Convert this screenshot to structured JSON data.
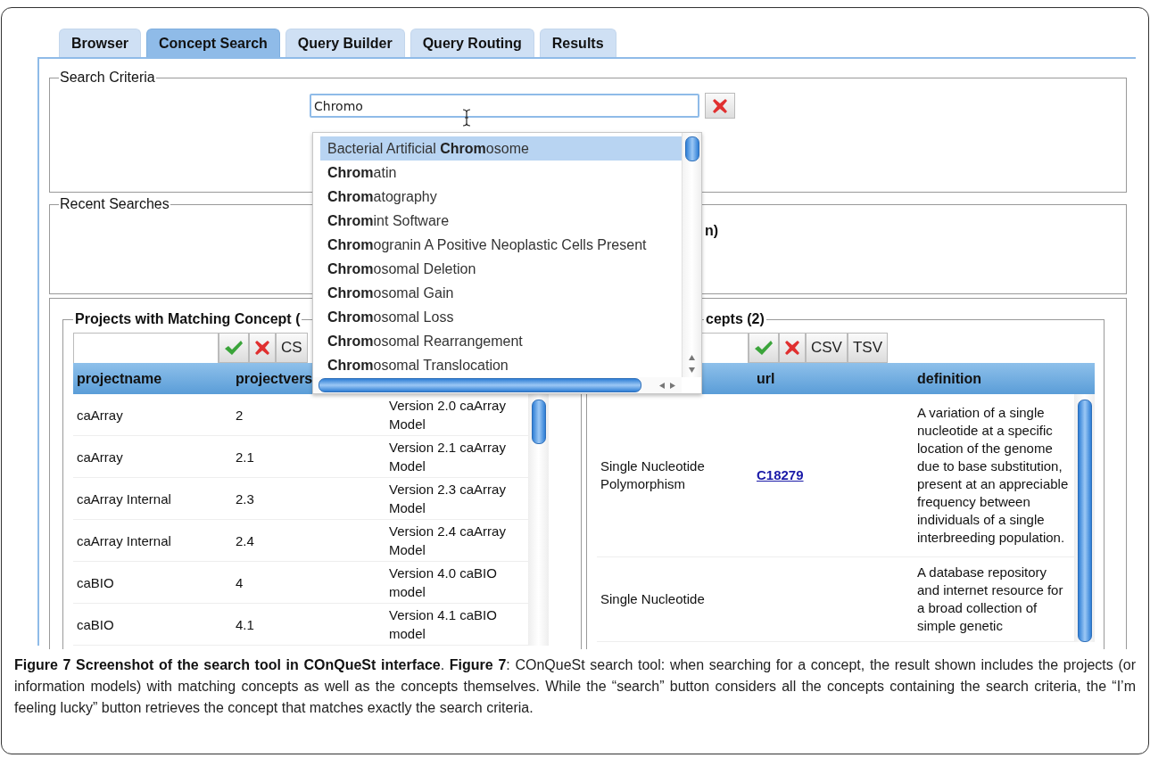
{
  "tabs": [
    {
      "label": "Browser",
      "selected": false
    },
    {
      "label": "Concept Search",
      "selected": true
    },
    {
      "label": "Query Builder",
      "selected": false
    },
    {
      "label": "Query Routing",
      "selected": false
    },
    {
      "label": "Results",
      "selected": false
    }
  ],
  "search_criteria": {
    "title": "Search Criteria",
    "value": "Chromo"
  },
  "suggestions": [
    {
      "label": "Bacterial Artificial **Chrom**osome",
      "selected": true
    },
    {
      "label": "**Chrom**atin",
      "selected": false
    },
    {
      "label": "**Chrom**atography",
      "selected": false
    },
    {
      "label": "**Chrom**int Software",
      "selected": false
    },
    {
      "label": "**Chrom**ogranin A Positive Neoplastic Cells Present",
      "selected": false
    },
    {
      "label": "**Chrom**osomal Deletion",
      "selected": false
    },
    {
      "label": "**Chrom**osomal Gain",
      "selected": false
    },
    {
      "label": "**Chrom**osomal Loss",
      "selected": false
    },
    {
      "label": "**Chrom**osomal Rearrangement",
      "selected": false
    },
    {
      "label": "**Chrom**osomal Translocation",
      "selected": false
    }
  ],
  "recent_searches": {
    "title": "Recent Searches",
    "text": "n)"
  },
  "tables": [
    {
      "title": "Projects with Matching Concept (",
      "buttons": [
        "CS"
      ],
      "columns": [
        "projectname",
        "projectvers"
      ],
      "rows": [
        [
          "caArray",
          "2",
          "Version 2.0 caArray Model"
        ],
        [
          "caArray",
          "2.1",
          "Version 2.1 caArray Model"
        ],
        [
          "caArray Internal",
          "2.3",
          "Version 2.3 caArray Model"
        ],
        [
          "caArray Internal",
          "2.4",
          "Version 2.4 caArray Model"
        ],
        [
          "caBIO",
          "4",
          "Version 4.0 caBIO model"
        ],
        [
          "caBIO",
          "4.1",
          "Version 4.1 caBIO model"
        ]
      ]
    },
    {
      "title": "cepts (2)",
      "buttons": [
        "CSV",
        "TSV"
      ],
      "columns": [
        "",
        "url",
        "definition"
      ],
      "rows": [
        [
          "Single Nucleotide Polymorphism",
          {
            "text": "C18279",
            "kind": "link"
          },
          "A variation of a single nucleotide at a specific location of the genome due to base substitution, present at an appreciable frequency between individuals of a single interbreeding population."
        ],
        [
          "Single Nucleotide",
          null,
          "A database repository and internet resource for a broad collection of simple genetic"
        ]
      ]
    }
  ],
  "caption": "**Figure 7 Screenshot of the search tool in COnQueSt interface**. **Figure 7**: COnQueSt search tool: when searching for a concept, the result shown includes the projects (or information models) with matching concepts as well as the concepts themselves. While the “search” button considers all the concepts containing the search criteria, the “I’m feeling lucky” button retrieves the concept that matches exactly the search criteria."
}
